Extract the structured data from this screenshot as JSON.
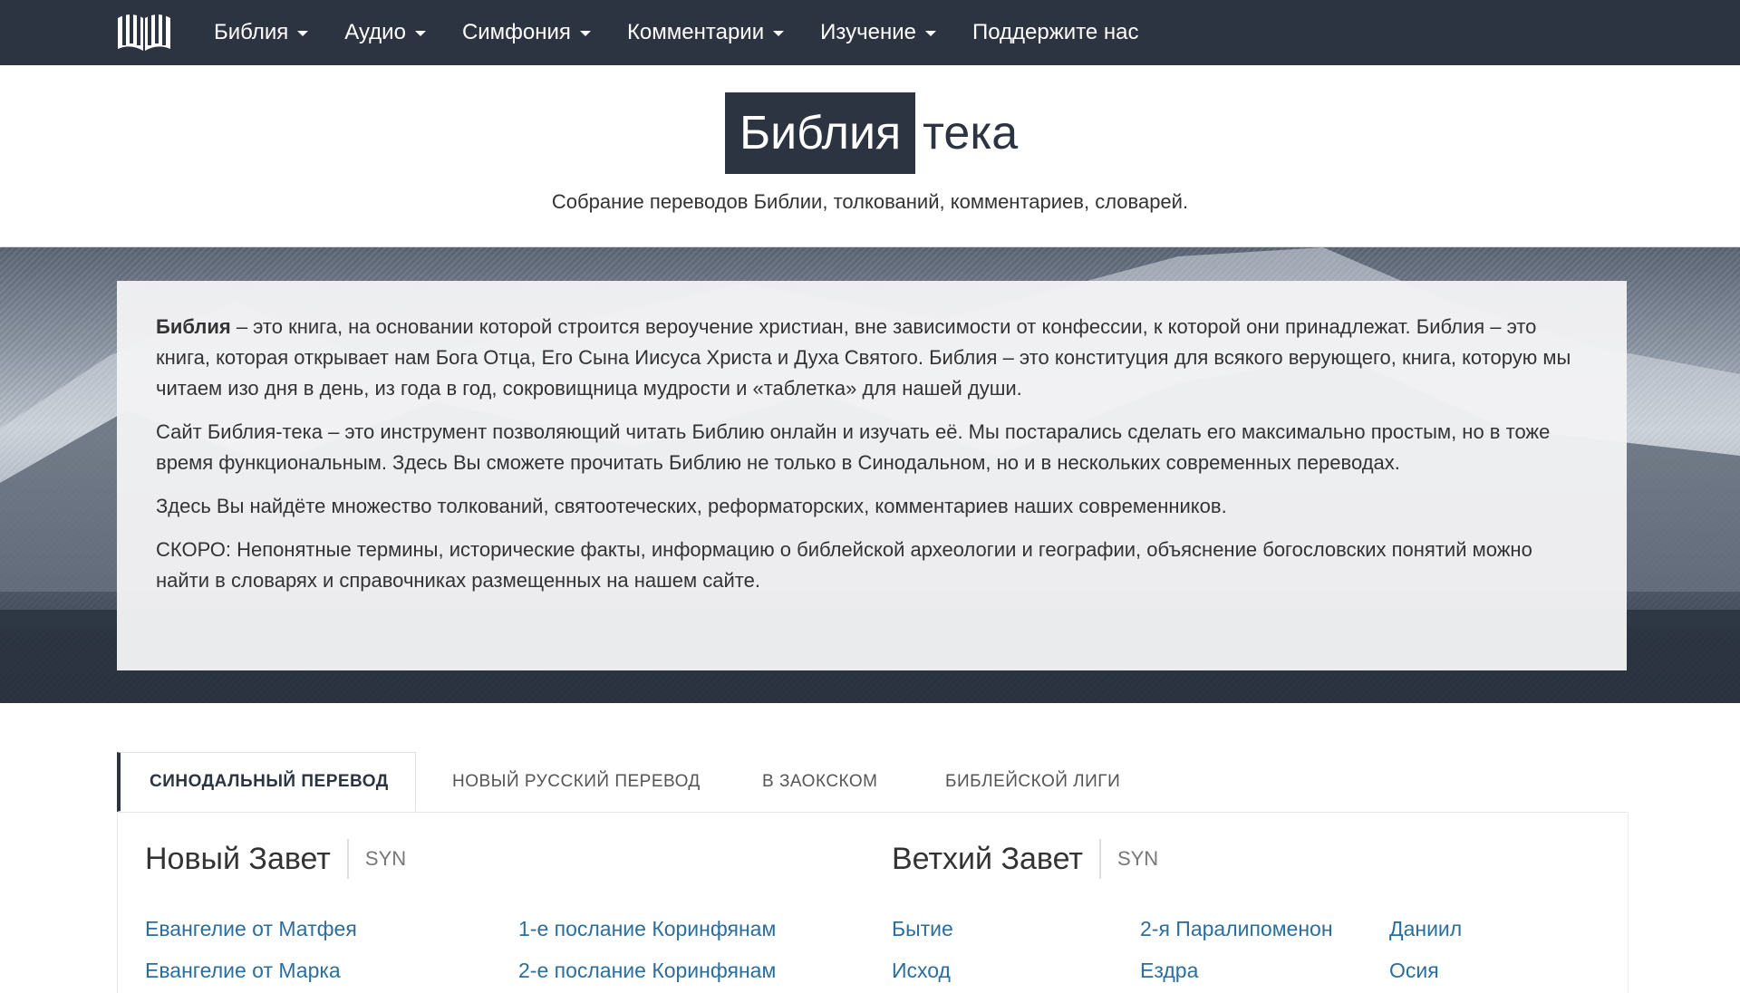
{
  "nav": {
    "items": [
      {
        "label": "Библия",
        "dropdown": true
      },
      {
        "label": "Аудио",
        "dropdown": true
      },
      {
        "label": "Симфония",
        "dropdown": true
      },
      {
        "label": "Комментарии",
        "dropdown": true
      },
      {
        "label": "Изучение",
        "dropdown": true
      },
      {
        "label": "Поддержите нас",
        "dropdown": false
      }
    ]
  },
  "brand": {
    "part1": "Библия",
    "part2": "тека",
    "tagline": "Собрание переводов Библии, толкований, комментариев, словарей."
  },
  "intro": {
    "p1_bold": "Библия",
    "p1_rest": " – это книга, на основании которой строится вероучение христиан, вне зависимости от конфессии, к которой они принадлежат. Библия – это книга, которая открывает нам Бога Отца, Его Сына Иисуса Христа и Духа Святого. Библия – это конституция для всякого верующего, книга, которую мы читаем изо дня в день, из года в год, сокровищница мудрости и «таблетка» для нашей души.",
    "p2": "Сайт Библия-тека – это инструмент позволяющий читать Библию онлайн и изучать её. Мы постарались сделать его максимально простым, но в тоже время функциональным. Здесь Вы сможете прочитать Библию не только в Синодальном, но и в нескольких современных переводах.",
    "p3": "Здесь Вы найдёте множество толкований, святоотеческих, реформаторских, комментариев наших современников.",
    "p4": "СКОРО: Непонятные термины, исторические факты, информацию о библейской археологии и географии, объяснение богословских понятий можно найти в словарях и справочниках размещенных на нашем сайте."
  },
  "tabs": [
    {
      "label": "СИНОДАЛЬНЫЙ ПЕРЕВОД",
      "active": true
    },
    {
      "label": "НОВЫЙ РУССКИЙ ПЕРЕВОД",
      "active": false
    },
    {
      "label": "В ЗАОКСКОМ",
      "active": false
    },
    {
      "label": "БИБЛЕЙСКОЙ ЛИГИ",
      "active": false
    }
  ],
  "new_testament": {
    "title": "Новый Завет",
    "code": "SYN",
    "col1": [
      "Евангелие от Матфея",
      "Евангелие от Марка"
    ],
    "col2": [
      "1-е послание Коринфянам",
      "2-е послание Коринфянам"
    ]
  },
  "old_testament": {
    "title": "Ветхий Завет",
    "code": "SYN",
    "col1": [
      "Бытие",
      "Исход"
    ],
    "col2": [
      "2-я Паралипоменон",
      "Ездра"
    ],
    "col3": [
      "Даниил",
      "Осия"
    ]
  },
  "colors": {
    "navbar": "#2c3441",
    "link": "#2b6e9e",
    "panel": "#f2f3f5"
  }
}
